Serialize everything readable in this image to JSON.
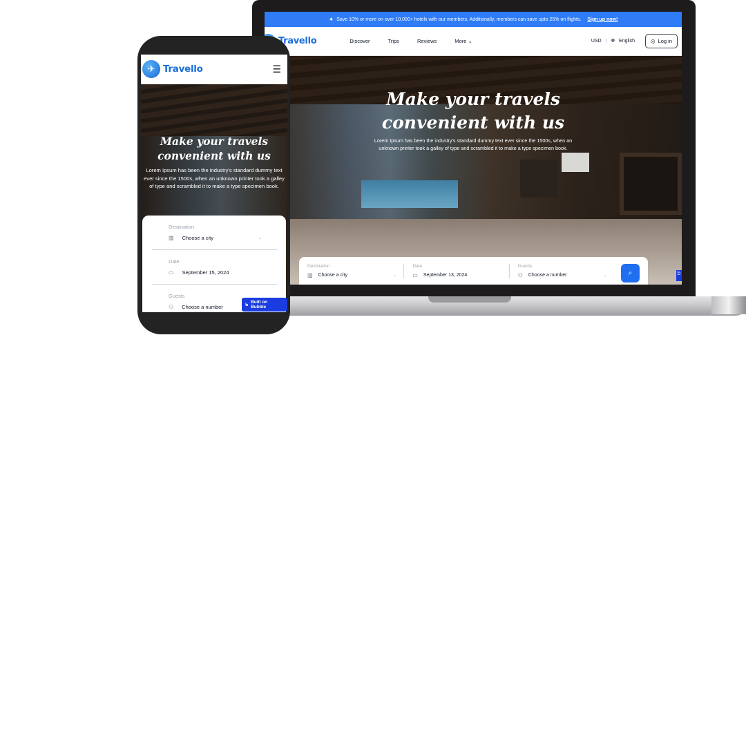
{
  "brand": {
    "name": "Travello",
    "logo_icon": "plane-icon",
    "accent": "#1c6fd8"
  },
  "desktop": {
    "promo": {
      "text": "Save 10% or more on over 10,000+ hotels with our members. Additionally, members can save upto 25% on flights.",
      "link": "Sign up now!"
    },
    "nav": {
      "links": [
        "Discover",
        "Trips",
        "Reviews",
        "More"
      ],
      "currency": "USD",
      "language": "English",
      "login": "Log in"
    },
    "hero": {
      "title_line1": "Make your travels",
      "title_line2": "convenient with us",
      "description": "Lorem Ipsum has been the industry's standard dummy text ever since the 1500s, when an unknown printer took a galley of type and scrambled it to make a type specimen book."
    },
    "search": {
      "destination_label": "Destination",
      "destination_value": "Choose a city",
      "date_label": "Date",
      "date_value": "September 13, 2024",
      "guests_label": "Guests",
      "guests_value": "Choose a number"
    }
  },
  "mobile": {
    "hero": {
      "title_line1": "Make your travels",
      "title_line2": "convenient with us",
      "description": "Lorem Ipsum has been the industry's standard dummy text ever since the 1500s, when an unknown printer took a galley of type and scrambled it to make a type specimen book."
    },
    "search": {
      "destination_label": "Destination",
      "destination_value": "Choose a city",
      "date_label": "Date",
      "date_value": "September 15, 2024",
      "guests_label": "Guests",
      "guests_value": "Choose a number"
    },
    "badge": "Built on Bubble"
  }
}
